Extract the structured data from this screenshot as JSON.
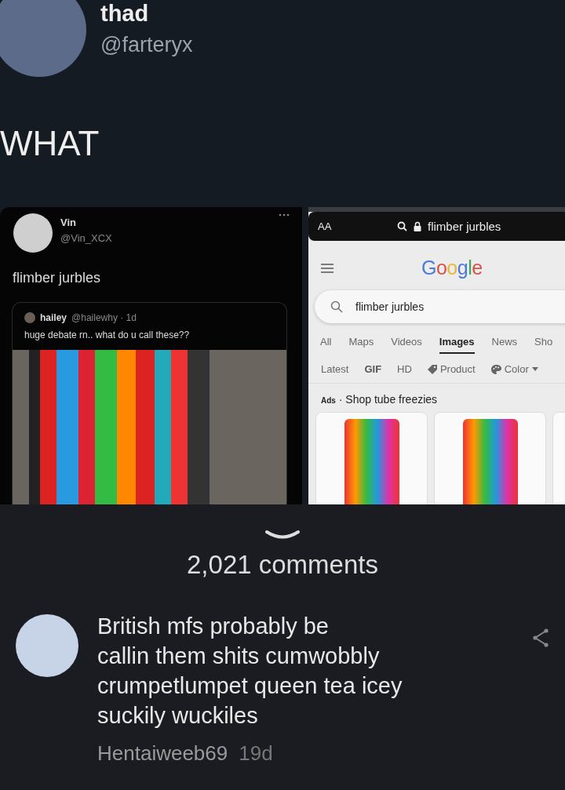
{
  "post": {
    "author": {
      "name": "thad",
      "handle": "@farteryx"
    },
    "text": "WHAT",
    "tweet": {
      "author": {
        "name": "Vin",
        "handle": "@Vin_XCX"
      },
      "text": "flimber jurbles",
      "quote": {
        "name": "hailey",
        "meta": "@hailewhy · 1d",
        "text": "huge debate rn.. what do u call these??"
      }
    },
    "browser": {
      "text_size": "AA",
      "address": "flimber jurbles",
      "logo": "Google",
      "query": "flimber jurbles",
      "tabs": [
        {
          "label": "All",
          "selected": false
        },
        {
          "label": "Maps",
          "selected": false
        },
        {
          "label": "Videos",
          "selected": false
        },
        {
          "label": "Images",
          "selected": true
        },
        {
          "label": "News",
          "selected": false
        },
        {
          "label": "Sho",
          "selected": false
        }
      ],
      "filters": [
        {
          "label": "Latest",
          "kind": "plain"
        },
        {
          "label": "GIF",
          "kind": "bold"
        },
        {
          "label": "HD",
          "kind": "plain"
        },
        {
          "label": "Product",
          "kind": "tag"
        },
        {
          "label": "Color",
          "kind": "color"
        }
      ],
      "ads": "**Ads** · Shop tube freezies"
    }
  },
  "comments": {
    "count": "2,021 comments"
  },
  "comment": {
    "text_lines": [
      "British mfs probably be",
      "callin them shits cumwobbly",
      "crumpetlumpet queen tea icey",
      "suckily wuckiles"
    ],
    "author": "Hentaiweeb69",
    "age": "19d"
  }
}
